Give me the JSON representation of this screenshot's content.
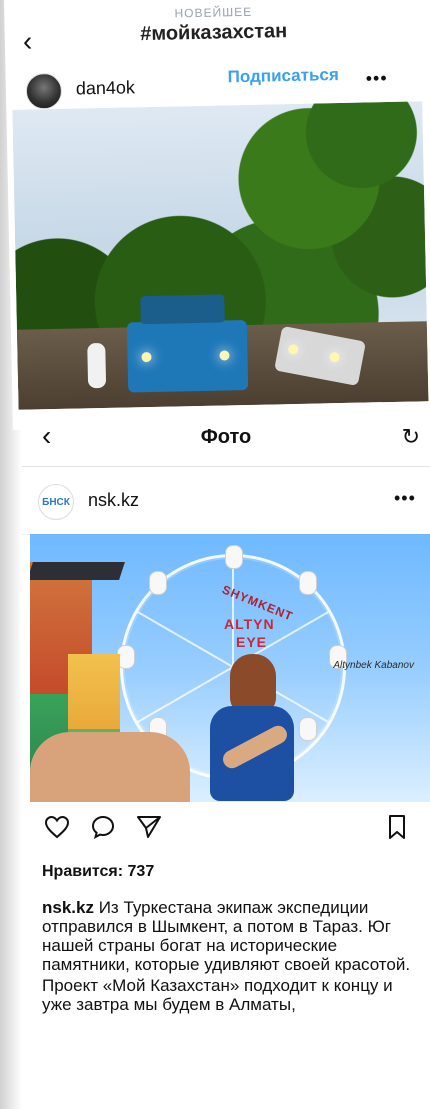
{
  "header": {
    "subtitle": "НОВЕЙШЕЕ",
    "title": "#мойказахстан"
  },
  "post1": {
    "username": "dan4ok",
    "follow_label": "Подписаться",
    "more_glyph": "•••"
  },
  "screen2": {
    "title": "Фото",
    "username": "nsk.kz",
    "avatar_text": "БНСК",
    "more_glyph": "•••",
    "likes_text": "Нравится: 737",
    "caption": {
      "username": "nsk.kz",
      "line1": " Из Туркестана экипаж экспедиции отправился в Шымкент, а потом в Тараз. Юг нашей страны богат на исторические памятники, которые удивляют своей красотой.",
      "line2": "Проект «Мой Казахстан» подходит к концу и уже завтра мы будем в Алматы,"
    }
  },
  "photo_text": {
    "arc": "SHYMKENT",
    "name": "ALTYN",
    "eye": "EYE",
    "signature": "Altynbek Kabanov"
  },
  "icons": {
    "back": "chevron-left-icon",
    "more": "more-icon",
    "refresh": "refresh-icon",
    "like": "heart-icon",
    "comment": "comment-icon",
    "share": "paper-plane-icon",
    "save": "bookmark-icon"
  },
  "colors": {
    "follow_blue": "#3aa0f0",
    "text": "#111111",
    "muted": "#9aa3ad"
  }
}
